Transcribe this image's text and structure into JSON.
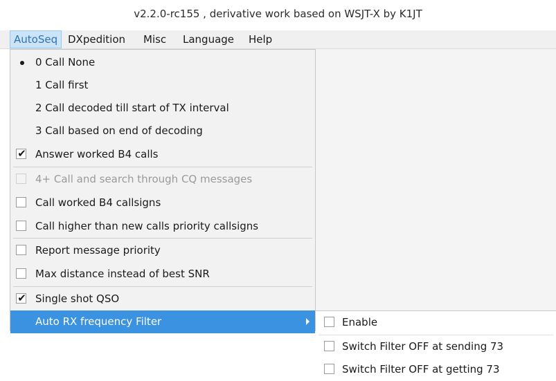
{
  "window": {
    "title": "v2.2.0-rc155 , derivative work based on WSJT-X by K1JT"
  },
  "menubar": {
    "items": [
      {
        "label": "AutoSeq"
      },
      {
        "label": "DXpedition"
      },
      {
        "label": "Misc"
      },
      {
        "label": "Language"
      },
      {
        "label": "Help"
      }
    ],
    "active": "AutoSeq"
  },
  "autoseq_menu": {
    "items": [
      {
        "label": "0  Call None",
        "type": "radio",
        "selected": true
      },
      {
        "label": "1  Call first",
        "type": "radio",
        "selected": false
      },
      {
        "label": "2  Call decoded till start of TX interval",
        "type": "radio",
        "selected": false
      },
      {
        "label": "3  Call based on end of decoding",
        "type": "radio",
        "selected": false
      },
      {
        "label": "Answer worked B4 calls",
        "type": "checkbox",
        "checked": true
      },
      {
        "label": "4+ Call and search through CQ messages",
        "type": "checkbox",
        "checked": false,
        "disabled": true
      },
      {
        "label": "Call worked B4 callsigns",
        "type": "checkbox",
        "checked": false
      },
      {
        "label": "Call higher than new calls priority callsigns",
        "type": "checkbox",
        "checked": false
      },
      {
        "label": "Report message priority",
        "type": "checkbox",
        "checked": false
      },
      {
        "label": "Max distance instead of best SNR",
        "type": "checkbox",
        "checked": false
      },
      {
        "label": "Single shot QSO",
        "type": "checkbox",
        "checked": true
      },
      {
        "label": "Auto RX frequency Filter",
        "type": "submenu",
        "highlighted": true
      }
    ]
  },
  "auto_rx_submenu": {
    "items": [
      {
        "label": "Enable",
        "checked": false
      },
      {
        "label": "Switch Filter OFF at sending 73",
        "checked": false
      },
      {
        "label": "Switch Filter OFF at getting 73",
        "checked": false
      }
    ]
  },
  "icons": {
    "radio_selected": "bullet-icon",
    "check": "check-icon",
    "submenu_arrow": "chevron-right-icon"
  },
  "colors": {
    "highlight": "#3a92e0",
    "active_menu": "#cce4f7",
    "active_menu_text": "#3072b3"
  }
}
